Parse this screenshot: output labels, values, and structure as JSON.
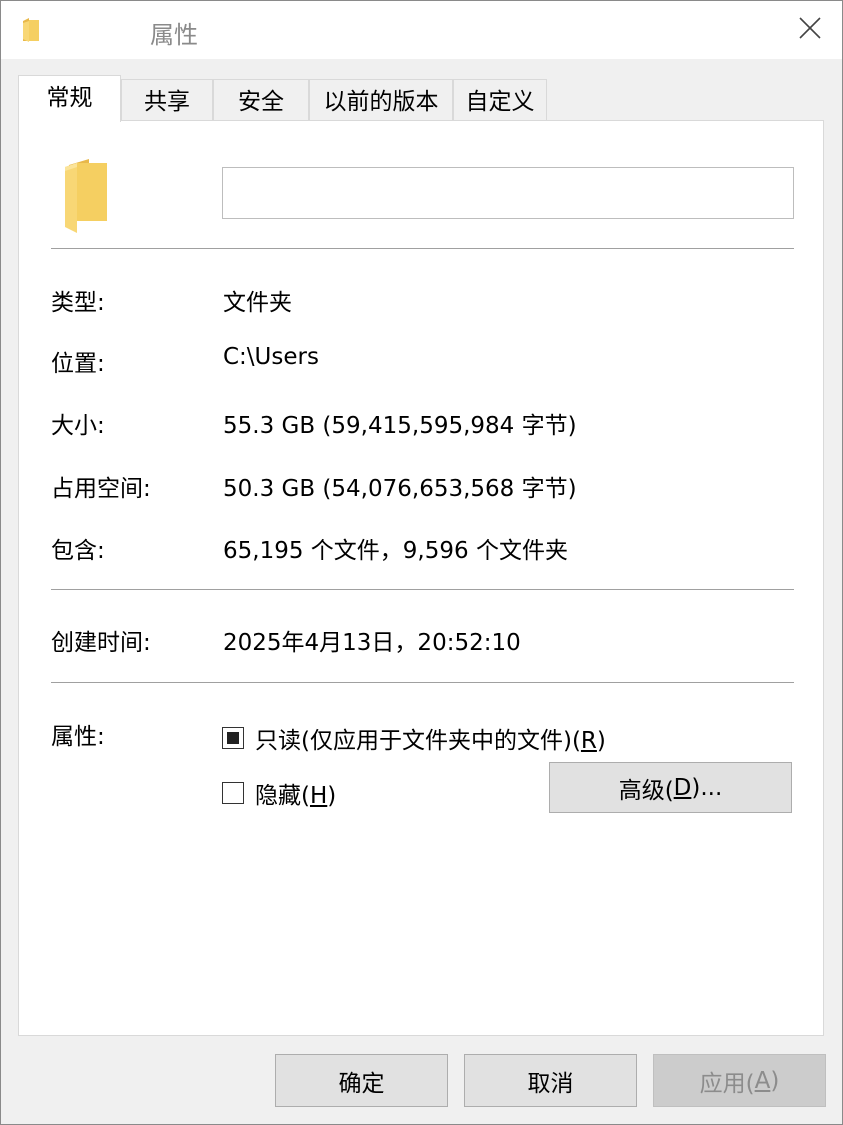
{
  "window": {
    "title": "属性"
  },
  "tabs": [
    {
      "label": "常规"
    },
    {
      "label": "共享"
    },
    {
      "label": "安全"
    },
    {
      "label": "以前的版本"
    },
    {
      "label": "自定义"
    }
  ],
  "general": {
    "name_value": "",
    "rows": {
      "type": {
        "label": "类型:",
        "value": "文件夹"
      },
      "location": {
        "label": "位置:",
        "value": "C:\\Users"
      },
      "size": {
        "label": "大小:",
        "value": "55.3 GB (59,415,595,984 字节)"
      },
      "size_on_disk": {
        "label": "占用空间:",
        "value": "50.3 GB (54,076,653,568 字节)"
      },
      "contains": {
        "label": "包含:",
        "value": "65,195 个文件，9,596 个文件夹"
      },
      "created": {
        "label": "创建时间:",
        "value": "2025年4月13日，20:52:10"
      },
      "attributes": {
        "label": "属性:"
      }
    },
    "readonly": {
      "label": "只读(仅应用于文件夹中的文件)(",
      "key": "R",
      "suffix": ")",
      "state": "indeterminate"
    },
    "hidden": {
      "label": "隐藏(",
      "key": "H",
      "suffix": ")",
      "checked": false
    },
    "advanced": {
      "label": "高级(",
      "key": "D",
      "suffix": ")..."
    }
  },
  "footer": {
    "ok": "确定",
    "cancel": "取消",
    "apply": {
      "label": "应用(",
      "key": "A",
      "suffix": ")"
    }
  },
  "colors": {
    "folder_front": "#f8d775",
    "folder_back": "#e8b84a"
  }
}
